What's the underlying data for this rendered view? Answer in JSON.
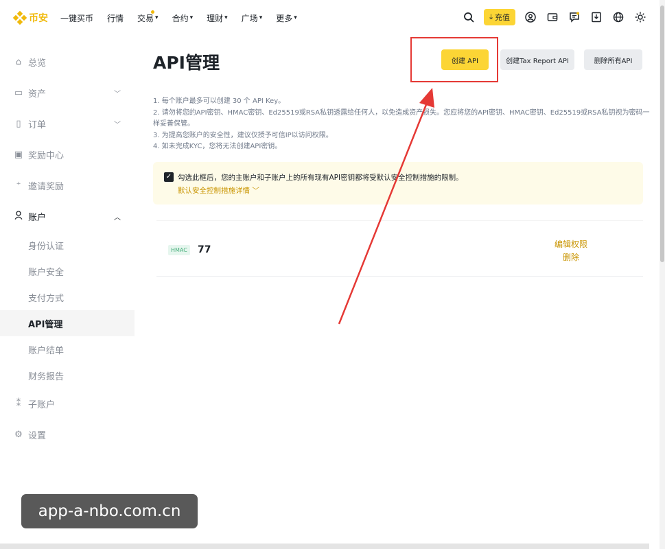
{
  "topbar": {
    "logo_text": "币安",
    "nav": [
      {
        "label": "一键买币",
        "chevron": false
      },
      {
        "label": "行情",
        "chevron": false
      },
      {
        "label": "交易",
        "chevron": true
      },
      {
        "label": "合约",
        "chevron": true
      },
      {
        "label": "理财",
        "chevron": true
      },
      {
        "label": "广场",
        "chevron": true
      },
      {
        "label": "更多",
        "chevron": true
      }
    ],
    "deposit_label": "充值",
    "icons": [
      "search-icon",
      "download-icon",
      "user-icon",
      "wallet-icon",
      "message-icon",
      "app-download-icon",
      "globe-icon",
      "theme-icon"
    ]
  },
  "sidebar": {
    "items": [
      {
        "label": "总览",
        "icon": "home-icon"
      },
      {
        "label": "资产",
        "icon": "assets-icon",
        "chevron": "down"
      },
      {
        "label": "订单",
        "icon": "orders-icon",
        "chevron": "down"
      },
      {
        "label": "奖励中心",
        "icon": "reward-icon"
      },
      {
        "label": "邀请奖励",
        "icon": "invite-icon"
      },
      {
        "label": "账户",
        "icon": "account-icon",
        "chevron": "up"
      }
    ],
    "account_sub": [
      "身份认证",
      "账户安全",
      "支付方式",
      "API管理",
      "账户结单",
      "财务报告"
    ],
    "active_sub": "API管理",
    "bottom_items": [
      {
        "label": "子账户",
        "icon": "subaccount-icon"
      },
      {
        "label": "设置",
        "icon": "settings-icon"
      }
    ]
  },
  "main": {
    "title": "API管理",
    "buttons": {
      "create": "创建 API",
      "tax": "创建Tax Report API",
      "delete_all": "删除所有API"
    },
    "notes": [
      "1. 每个账户最多可以创建 30 个 API Key。",
      "2. 请勿将您的API密钥、HMAC密钥、Ed25519或RSA私钥透露给任何人，以免造成资产损失。您应将您的API密钥、HMAC密钥、Ed25519或RSA私钥视为密码一样妥善保管。",
      "3. 为提高您账户的安全性，建议仅授予可信IP以访问权限。",
      "4. 如未完成KYC，您将无法创建API密钥。"
    ],
    "agreement": {
      "text": "勾选此框后，您的主账户和子账户上的所有现有API密钥都将受默认安全控制措施的限制。",
      "link": "默认安全控制措施详情"
    },
    "api_key": {
      "type": "HMAC",
      "name": "77",
      "actions": [
        "编辑权限",
        "删除"
      ]
    }
  },
  "watermark": "app-a-nbo.com.cn",
  "colors": {
    "brand": "#f0b90b",
    "button_yellow": "#fcd535",
    "link_gold": "#c99400",
    "annotation_red": "#e53935"
  }
}
